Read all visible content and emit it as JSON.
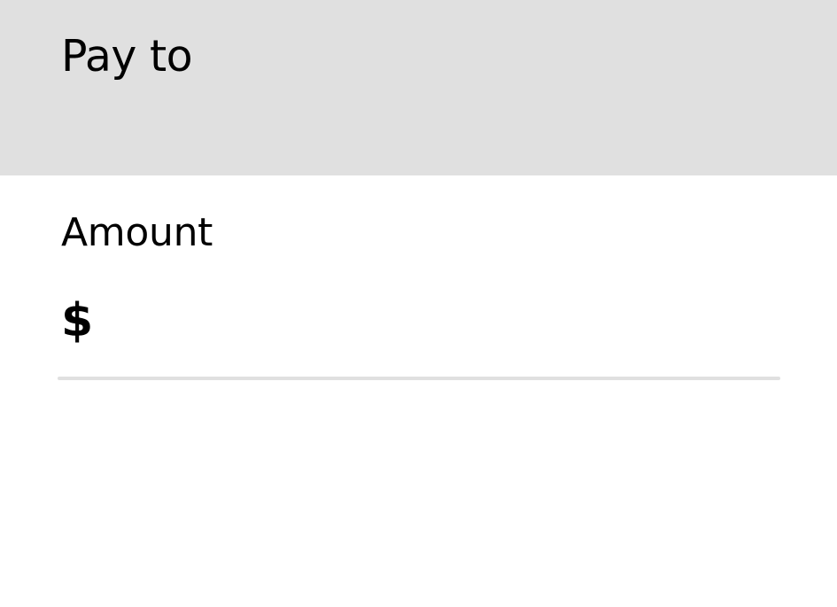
{
  "header": {
    "title": "Pay to"
  },
  "amount": {
    "label": "Amount",
    "currency_symbol": "$",
    "value": "",
    "placeholder": ""
  },
  "colors": {
    "header_background": "#e0e0e0",
    "page_background": "#ffffff",
    "text": "#000000",
    "underline": "#e0e0e0"
  }
}
